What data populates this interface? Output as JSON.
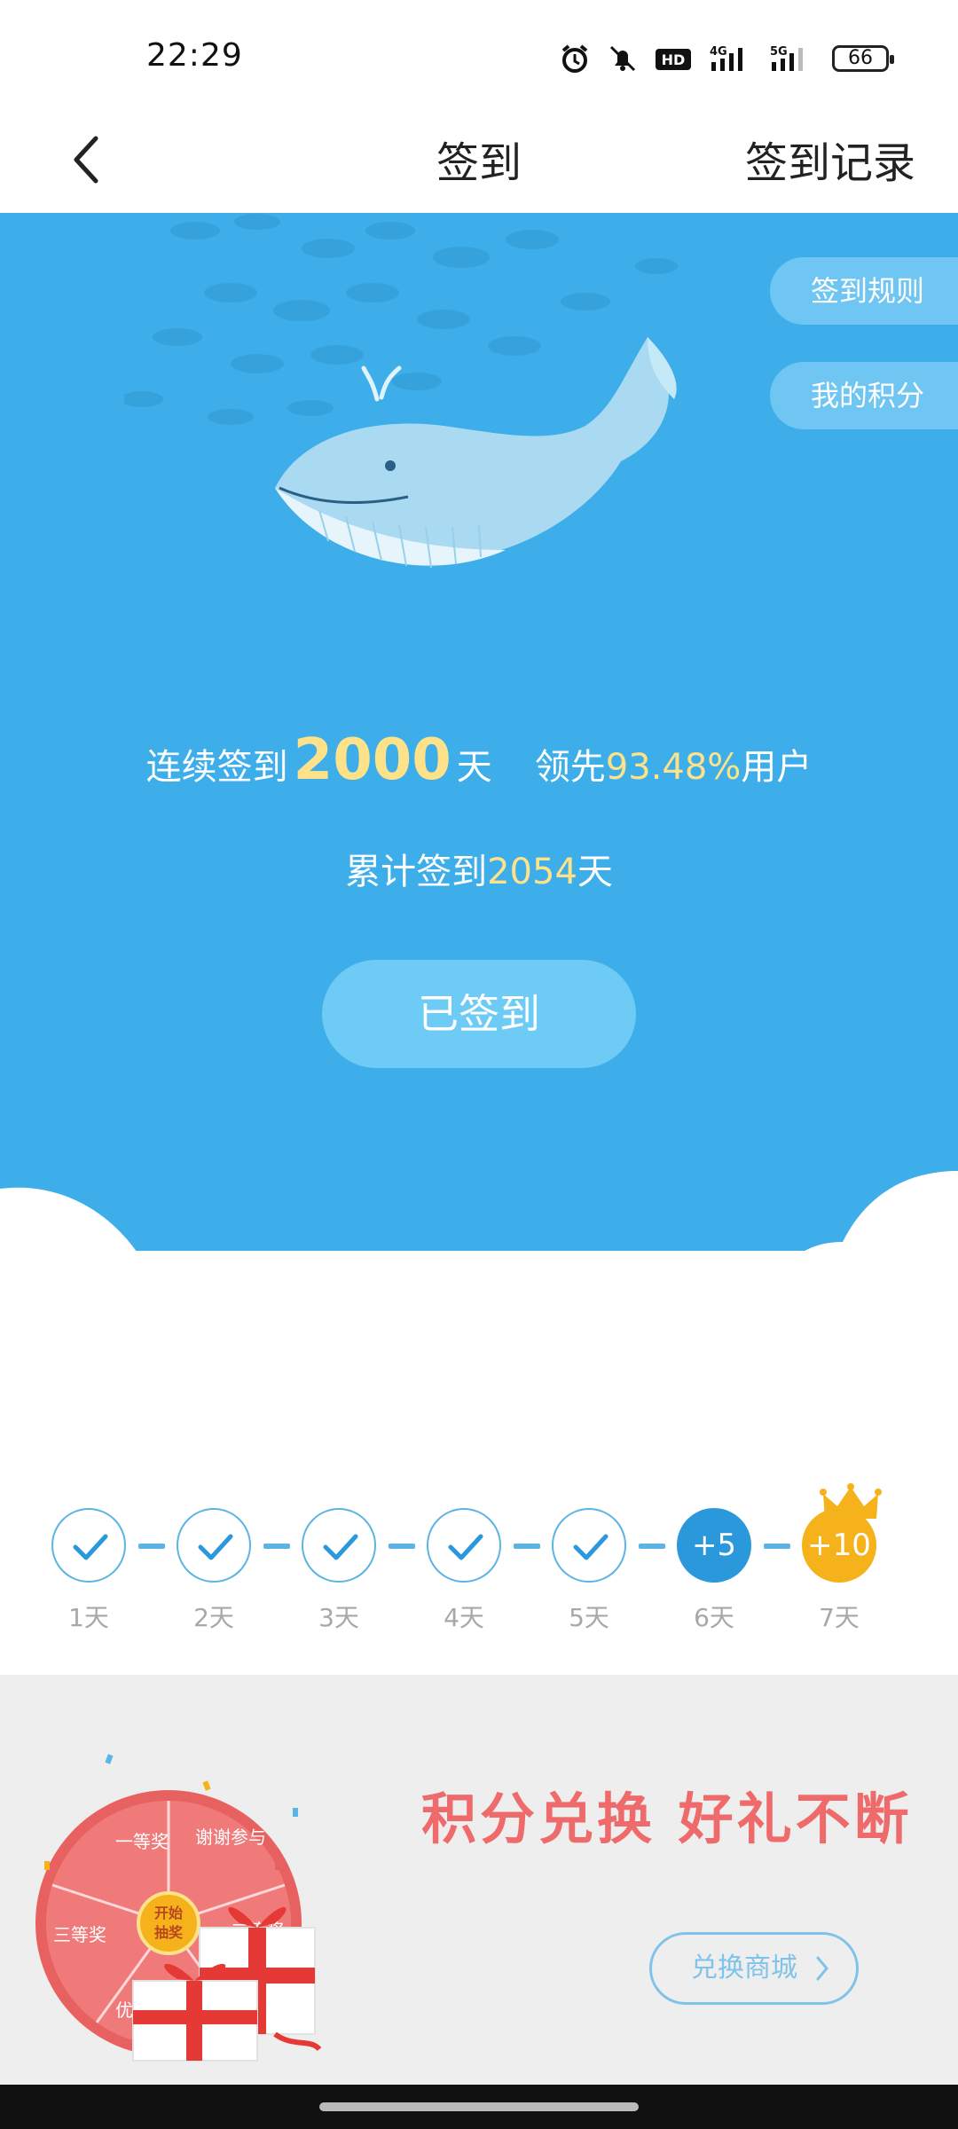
{
  "status": {
    "time": "22:29",
    "battery": "66"
  },
  "appbar": {
    "title": "签到",
    "record": "签到记录"
  },
  "hero": {
    "rules": "签到规则",
    "points": "我的积分",
    "streak_prefix": "连续签到",
    "streak_days": "2000",
    "streak_unit": "天",
    "lead_prefix": "领先",
    "lead_pct": "93.48%",
    "lead_suffix": "用户",
    "total_prefix": "累计签到",
    "total_days": "2054",
    "total_unit": "天",
    "checked_label": "已签到"
  },
  "days": [
    {
      "label": "1天",
      "state": "checked"
    },
    {
      "label": "2天",
      "state": "checked"
    },
    {
      "label": "3天",
      "state": "checked"
    },
    {
      "label": "4天",
      "state": "checked"
    },
    {
      "label": "5天",
      "state": "checked"
    },
    {
      "label": "6天",
      "reward": "+5"
    },
    {
      "label": "7天",
      "reward": "+10"
    }
  ],
  "promo": {
    "title": "积分兑换  好礼不断",
    "button": "兑换商城",
    "wheel_center": [
      "开始",
      "抽奖"
    ],
    "wheel_labels": [
      "一等奖",
      "谢谢参与",
      "二等奖",
      "三等奖",
      "优秀奖"
    ]
  },
  "colors": {
    "sky": "#3daee9",
    "gold": "#f6b21b",
    "highlight": "#fde28a",
    "promo_red": "#ef6b6b"
  }
}
